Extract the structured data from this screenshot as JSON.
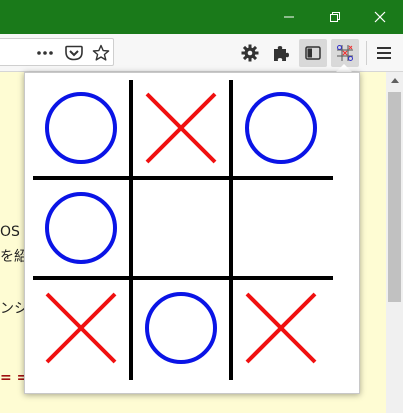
{
  "window": {
    "controls": [
      "minimize",
      "restore",
      "close"
    ]
  },
  "toolbar": {
    "url_actions": [
      "page-actions-menu",
      "pocket",
      "bookmark-star"
    ],
    "icons": [
      "gear-icon",
      "puzzle-icon",
      "sidebar-icon",
      "tictactoe-extension-icon",
      "hamburger-menu-icon"
    ]
  },
  "page": {
    "line1": "OS",
    "line2": "を紹",
    "line3": "ンシ",
    "line4": "= ="
  },
  "game": {
    "board": [
      [
        "O",
        "X",
        "O"
      ],
      [
        "O",
        "",
        ""
      ],
      [
        "X",
        "O",
        "X"
      ]
    ],
    "colors": {
      "o": "#0a14e6",
      "x": "#f01010",
      "grid": "#000000"
    }
  }
}
